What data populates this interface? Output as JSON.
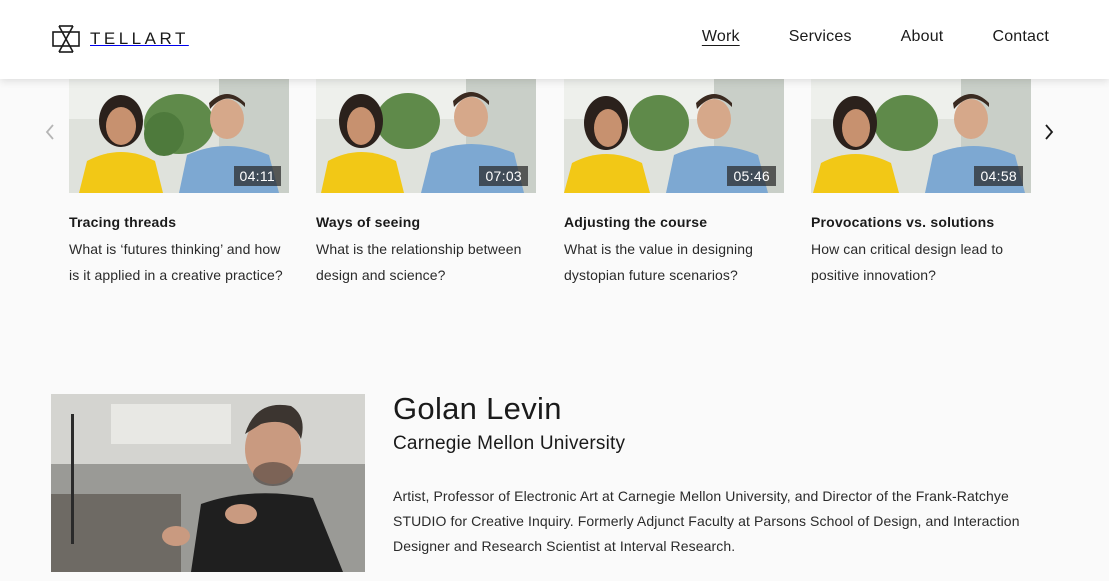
{
  "brand": {
    "name": "TELLART",
    "icon": "tellart-logo-icon"
  },
  "nav": {
    "items": [
      {
        "label": "Work",
        "active": true
      },
      {
        "label": "Services",
        "active": false
      },
      {
        "label": "About",
        "active": false
      },
      {
        "label": "Contact",
        "active": false
      }
    ]
  },
  "carousel": {
    "prev_icon": "chevron-left-icon",
    "next_icon": "chevron-right-icon",
    "videos": [
      {
        "duration": "04:11",
        "title": "Tracing threads",
        "description": "What is ‘futures thinking’ and how is it applied in a creative practice?"
      },
      {
        "duration": "07:03",
        "title": "Ways of seeing",
        "description": "What is the relationship between design and science?"
      },
      {
        "duration": "05:46",
        "title": "Adjusting the course",
        "description": "What is the value in designing dystopian future scenarios?"
      },
      {
        "duration": "04:58",
        "title": "Provocations vs. solutions",
        "description": "How can critical design lead to positive innovation?"
      }
    ]
  },
  "person": {
    "name": "Golan Levin",
    "organization": "Carnegie Mellon University",
    "bio": "Artist, Professor of Electronic Art at Carnegie Mellon University, and Director of the Frank-Ratchye STUDIO for Creative Inquiry. Formerly Adjunct Faculty at Parsons School of Design, and Interaction Designer and Research Scientist at Interval Research."
  },
  "colors": {
    "background": "#fafafa",
    "header": "#ffffff",
    "text": "#1a1a1a",
    "duration_badge": "#282828"
  }
}
